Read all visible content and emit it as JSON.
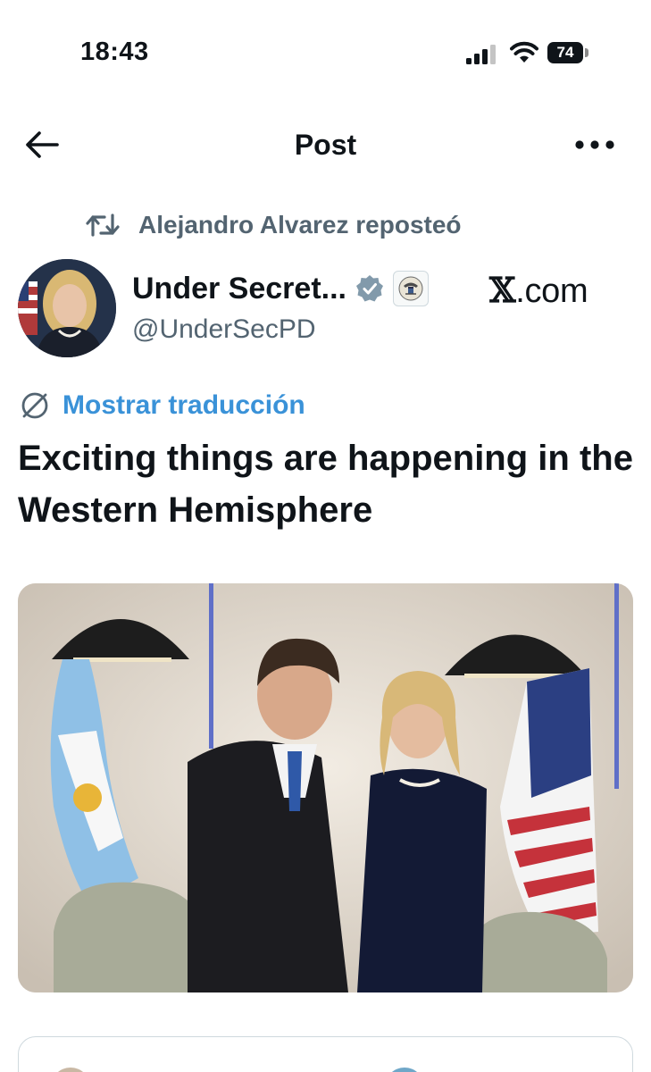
{
  "status_bar": {
    "time": "18:43",
    "battery": "74"
  },
  "header": {
    "title": "Post"
  },
  "repost": {
    "text": "Alejandro Alvarez reposteó"
  },
  "author": {
    "name": "Under Secret...",
    "handle": "@UnderSecPD",
    "source_label_x": "𝕏",
    "source_label_rest": ".com"
  },
  "translate": {
    "label": "Mostrar traducción"
  },
  "tweet": {
    "text": "Exciting things are happening in the Western Hemisphere"
  },
  "colors": {
    "link": "#3a92d8",
    "secondary_text": "#536471",
    "verified": "#829aab"
  },
  "icons": {
    "back": "arrow-left-icon",
    "more": "more-horizontal-icon",
    "repost": "repost-icon",
    "verified": "verified-badge-icon",
    "government": "government-seal-icon",
    "translate": "globe-icon",
    "signal": "cellular-signal-icon",
    "wifi": "wifi-icon",
    "battery": "battery-icon"
  }
}
